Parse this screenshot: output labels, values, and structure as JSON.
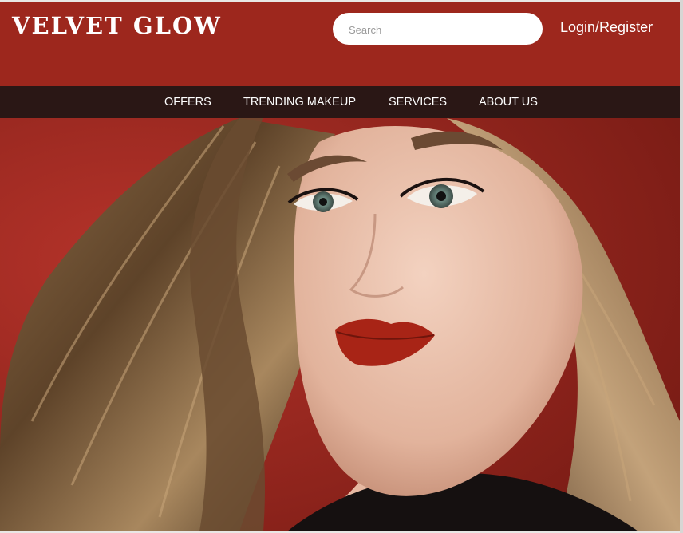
{
  "brand": {
    "name": "VELVET GLOW"
  },
  "search": {
    "placeholder": "Search"
  },
  "auth": {
    "label": "Login/Register"
  },
  "nav": {
    "items": [
      {
        "label": "OFFERS"
      },
      {
        "label": "TRENDING MAKEUP"
      },
      {
        "label": "SERVICES"
      },
      {
        "label": "ABOUT US"
      }
    ]
  },
  "colors": {
    "header_bg": "#9d271d",
    "nav_bg": "#2a1715",
    "text": "#ffffff",
    "lip": "#a82416"
  }
}
